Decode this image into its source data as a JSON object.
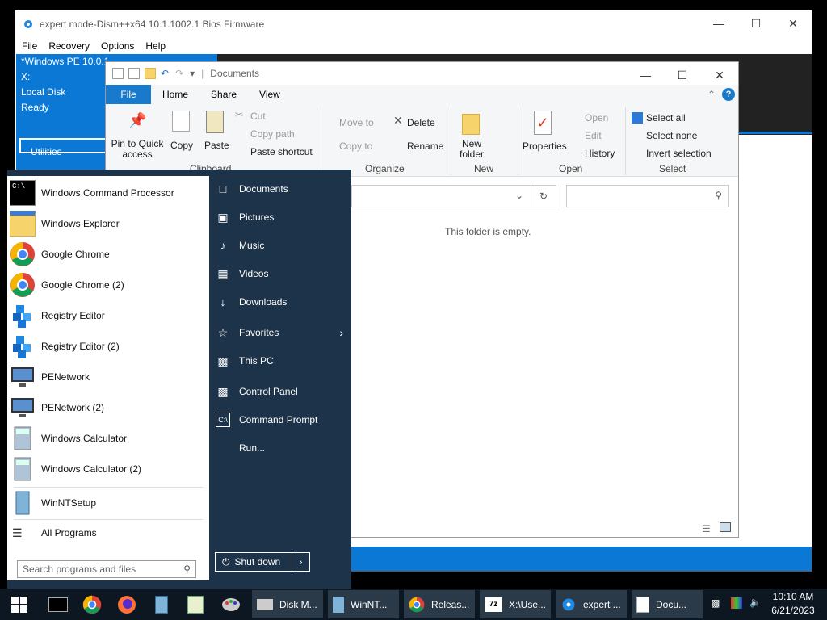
{
  "dism": {
    "title": "expert mode-Dism++x64 10.1.1002.1 Bios Firmware",
    "menu": [
      "File",
      "Recovery",
      "Options",
      "Help"
    ],
    "info": [
      "*Windows PE 10.0.1",
      "X:",
      "Local Disk",
      "Ready"
    ],
    "utilities": "Utilities"
  },
  "explorer": {
    "title": "Documents",
    "tabs": {
      "file": "File",
      "home": "Home",
      "share": "Share",
      "view": "View"
    },
    "ribbon": {
      "pin": "Pin to Quick access",
      "copy": "Copy",
      "paste": "Paste",
      "cut": "Cut",
      "copy_path": "Copy path",
      "paste_shortcut": "Paste shortcut",
      "clipboard": "Clipboard",
      "move_to": "Move to",
      "copy_to": "Copy to",
      "delete": "Delete",
      "rename": "Rename",
      "organize": "Organize",
      "new_folder": "New folder",
      "new": "New",
      "properties": "Properties",
      "open": "Open",
      "edit": "Edit",
      "history": "History",
      "open_group": "Open",
      "select_all": "Select all",
      "select_none": "Select none",
      "invert_selection": "Invert selection",
      "select_group": "Select"
    },
    "empty_text": "This folder is empty."
  },
  "start": {
    "programs": [
      "Windows Command Processor",
      "Windows Explorer",
      "Google Chrome",
      "Google Chrome (2)",
      "Registry Editor",
      "Registry Editor (2)",
      "PENetwork",
      "PENetwork (2)",
      "Windows Calculator",
      "Windows Calculator (2)"
    ],
    "winntsetup": "WinNTSetup",
    "all_programs": "All Programs",
    "search_placeholder": "Search programs and files",
    "right": [
      "Documents",
      "Pictures",
      "Music",
      "Videos",
      "Downloads",
      "Favorites",
      "This PC",
      "Control Panel",
      "Command Prompt",
      "Run..."
    ],
    "shutdown": "Shut down"
  },
  "taskbar": {
    "tasks": [
      "Disk M...",
      "WinNT...",
      "Releas...",
      "X:\\Use...",
      "expert ...",
      "Docu..."
    ],
    "time": "10:10 AM",
    "date": "6/21/2023"
  }
}
